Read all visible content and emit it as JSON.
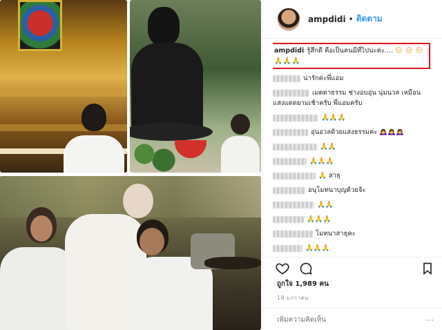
{
  "header": {
    "username": "ampdidi",
    "dot": "•",
    "follow_label": "ติดตาม"
  },
  "caption": {
    "username": "ampdidi",
    "text": "รู้สึกดี คือเป็นคนมีที่ไปน่ะค่ะ....",
    "emojis": "😑 😑 😑🙏🙏🙏"
  },
  "comments": [
    {
      "text": "น่ารักค่ะพี่แอม",
      "blur_user": true
    },
    {
      "text": "เมตตาธรรม ช่างอบอุ่น นุ่มนวล เหมือนแสงแดดยามเช้าครับ พี่แอมครับ",
      "blur_user": true
    },
    {
      "text": "🙏🙏🙏",
      "blur_user": true
    },
    {
      "text": "อุ่นอวลด้วยแสงธรรมค่ะ 🙇‍♀️🙇‍♀️🙇‍♀️",
      "blur_user": true
    },
    {
      "text": "🙏🙏",
      "blur_user": true
    },
    {
      "text": "🙏🙏🙏",
      "blur_user": true
    },
    {
      "text": "🙏 สาธุ",
      "blur_user": true
    },
    {
      "text": "อนุโมทนาบุญด้วยจ้ะ",
      "blur_user": true
    },
    {
      "text": "🙏🙏",
      "blur_user": true
    },
    {
      "text": "🙏🙏🙏",
      "blur_user": true
    },
    {
      "text": "โมทนาสาธุคะ",
      "blur_user": true
    },
    {
      "text": "🙏🙏🙏",
      "blur_user": true
    }
  ],
  "likes": {
    "label": "ถูกใจ 1,989 คน",
    "count": 1989
  },
  "date": "18 มกราคม",
  "add_comment": {
    "placeholder": "เพิ่มความคิดเห็น"
  },
  "more_label": "···",
  "icons": [
    "heart-icon",
    "comment-icon",
    "bookmark-icon"
  ],
  "colors": {
    "follow": "#3897f0",
    "highlight_box": "#e0111b"
  }
}
